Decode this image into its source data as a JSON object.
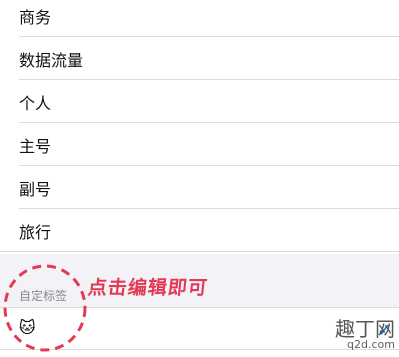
{
  "list": {
    "items": [
      {
        "label": "商务"
      },
      {
        "label": "数据流量"
      },
      {
        "label": "个人"
      },
      {
        "label": "主号"
      },
      {
        "label": "副号"
      },
      {
        "label": "旅行"
      }
    ]
  },
  "custom_section": {
    "header": "自定标签",
    "value": "🐱",
    "annotation": "点击编辑即可"
  },
  "watermark": {
    "main": "趣丁网",
    "sub": "q2d.com"
  },
  "colors": {
    "annotation": "#e33a54",
    "separator": "#dcdcdc",
    "section_bg": "#f2f2f7"
  }
}
